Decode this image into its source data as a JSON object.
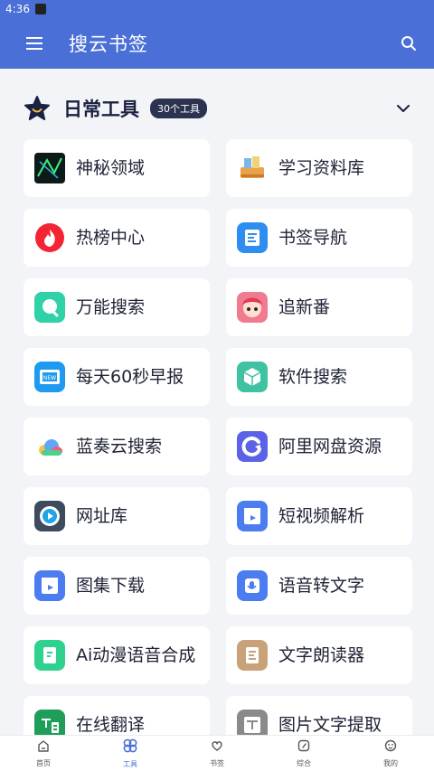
{
  "status_bar": {
    "time": "4:36"
  },
  "app_bar": {
    "title": "搜云书签",
    "menu_icon": "hamburger-menu-icon",
    "search_icon": "search-icon"
  },
  "section": {
    "title": "日常工具",
    "badge": "30个工具",
    "icon": "star-icon",
    "toggle_icon": "chevron-down-icon"
  },
  "tools": [
    {
      "label": "神秘领域",
      "icon": "mystery-icon",
      "color": "#0d1a1a"
    },
    {
      "label": "学习资料库",
      "icon": "books-icon",
      "color": "#f4ead8"
    },
    {
      "label": "热榜中心",
      "icon": "flame-icon",
      "color": "#f42434"
    },
    {
      "label": "书签导航",
      "icon": "bookmark-nav-icon",
      "color": "#2e8ef0"
    },
    {
      "label": "万能搜索",
      "icon": "search-bubble-icon",
      "color": "#2fd1a6"
    },
    {
      "label": "追新番",
      "icon": "anime-icon",
      "color": "#f07b90"
    },
    {
      "label": "每天60秒早报",
      "icon": "news-icon",
      "color": "#1e9bf0"
    },
    {
      "label": "软件搜索",
      "icon": "cube-icon",
      "color": "#3ec2a2"
    },
    {
      "label": "蓝奏云搜索",
      "icon": "cloud-icon",
      "color": "#5fa8f5"
    },
    {
      "label": "阿里网盘资源",
      "icon": "aliyun-drive-icon",
      "color": "#5b62e8"
    },
    {
      "label": "网址库",
      "icon": "play-circle-icon",
      "color": "#3e4a5e"
    },
    {
      "label": "短视频解析",
      "icon": "video-clapper-icon",
      "color": "#4b7df0"
    },
    {
      "label": "图集下载",
      "icon": "gallery-clapper-icon",
      "color": "#4b7df0"
    },
    {
      "label": "语音转文字",
      "icon": "voice-to-text-icon",
      "color": "#4b7df0"
    },
    {
      "label": "Ai动漫语音合成",
      "icon": "ai-voice-icon",
      "color": "#2fd18f"
    },
    {
      "label": "文字朗读器",
      "icon": "text-reader-icon",
      "color": "#c9a27a"
    },
    {
      "label": "在线翻译",
      "icon": "translate-icon",
      "color": "#1f9e5a"
    },
    {
      "label": "图片文字提取",
      "icon": "image-ocr-icon",
      "color": "#8a8a8a"
    }
  ],
  "bottom_nav": [
    {
      "label": "首页",
      "icon": "home-icon",
      "active": false
    },
    {
      "label": "工具",
      "icon": "clover-icon",
      "active": true
    },
    {
      "label": "书签",
      "icon": "heart-icon",
      "active": false
    },
    {
      "label": "综合",
      "icon": "compass-icon",
      "active": false
    },
    {
      "label": "我的",
      "icon": "profile-icon",
      "active": false
    }
  ],
  "colors": {
    "primary": "#4a6fd6",
    "background": "#f3f4f8"
  }
}
